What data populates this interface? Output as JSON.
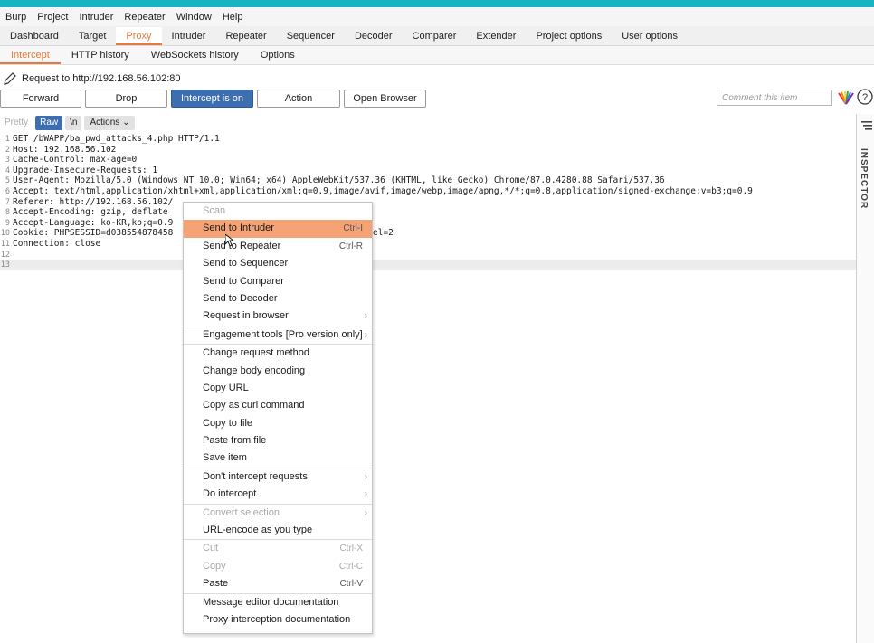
{
  "menubar": [
    "Burp",
    "Project",
    "Intruder",
    "Repeater",
    "Window",
    "Help"
  ],
  "main_tabs": [
    "Dashboard",
    "Target",
    "Proxy",
    "Intruder",
    "Repeater",
    "Sequencer",
    "Decoder",
    "Comparer",
    "Extender",
    "Project options",
    "User options"
  ],
  "sub_tabs": [
    "Intercept",
    "HTTP history",
    "WebSockets history",
    "Options"
  ],
  "request_line": "Request to http://192.168.56.102:80",
  "buttons": {
    "forward": "Forward",
    "drop": "Drop",
    "intercept": "Intercept is on",
    "action": "Action",
    "open_browser": "Open Browser"
  },
  "comment_placeholder": "Comment this item",
  "editor_toolbar": {
    "pretty": "Pretty",
    "raw": "Raw",
    "wn": "\\n",
    "actions": "Actions"
  },
  "inspector_label": "INSPECTOR",
  "request_lines": [
    "GET /bWAPP/ba_pwd_attacks_4.php HTTP/1.1",
    "Host: 192.168.56.102",
    "Cache-Control: max-age=0",
    "Upgrade-Insecure-Requests: 1",
    "User-Agent: Mozilla/5.0 (Windows NT 10.0; Win64; x64) AppleWebKit/537.36 (KHTML, like Gecko) Chrome/87.0.4280.88 Safari/537.36",
    "Accept: text/html,application/xhtml+xml,application/xml;q=0.9,image/avif,image/webp,image/apng,*/*;q=0.8,application/signed-exchange;v=b3;q=0.9",
    "Referer: http://192.168.56.102/",
    "Accept-Encoding: gzip, deflate",
    "Accept-Language: ko-KR,ko;q=0.9",
    "Cookie: PHPSESSID=d038554878458",
    "Connection: close",
    "",
    ""
  ],
  "cookie_tail": "el=2",
  "context_menu": [
    {
      "label": "Scan",
      "disabled": true
    },
    {
      "label": "Send to Intruder",
      "shortcut": "Ctrl-I",
      "highlight": true
    },
    {
      "label": "Send to Repeater",
      "shortcut": "Ctrl-R"
    },
    {
      "label": "Send to Sequencer"
    },
    {
      "label": "Send to Comparer"
    },
    {
      "label": "Send to Decoder"
    },
    {
      "label": "Request in browser",
      "submenu": true,
      "sep_after": true
    },
    {
      "label": "Engagement tools [Pro version only]",
      "submenu": true,
      "sep_after": true
    },
    {
      "label": "Change request method"
    },
    {
      "label": "Change body encoding"
    },
    {
      "label": "Copy URL"
    },
    {
      "label": "Copy as curl command"
    },
    {
      "label": "Copy to file"
    },
    {
      "label": "Paste from file"
    },
    {
      "label": "Save item",
      "sep_after": true
    },
    {
      "label": "Don't intercept requests",
      "submenu": true
    },
    {
      "label": "Do intercept",
      "submenu": true,
      "sep_after": true
    },
    {
      "label": "Convert selection",
      "submenu": true,
      "disabled": true
    },
    {
      "label": "URL-encode as you type",
      "sep_after": true
    },
    {
      "label": "Cut",
      "shortcut": "Ctrl-X",
      "disabled": true
    },
    {
      "label": "Copy",
      "shortcut": "Ctrl-C",
      "disabled": true
    },
    {
      "label": "Paste",
      "shortcut": "Ctrl-V",
      "sep_after": true
    },
    {
      "label": "Message editor documentation"
    },
    {
      "label": "Proxy interception documentation"
    }
  ],
  "colors": {
    "accent": "#e8793a",
    "primary_button": "#3d6eaf",
    "menu_highlight": "#f5a374",
    "titlebar": "#18b4c4"
  }
}
